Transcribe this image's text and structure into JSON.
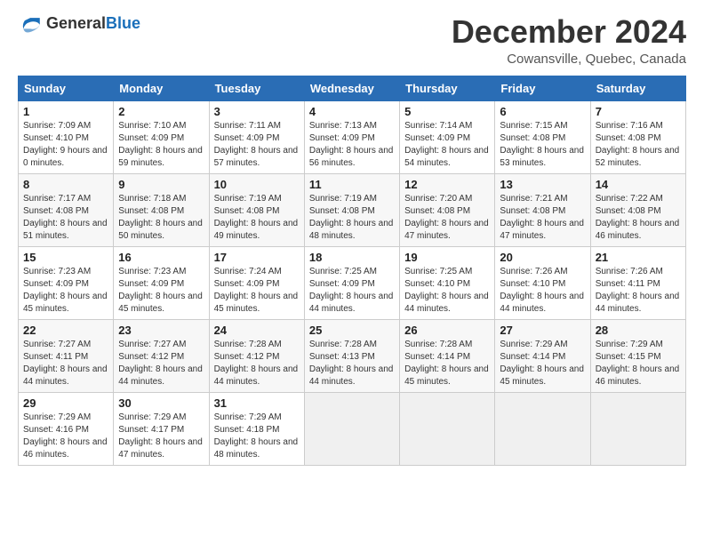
{
  "header": {
    "logo_general": "General",
    "logo_blue": "Blue",
    "month": "December 2024",
    "location": "Cowansville, Quebec, Canada"
  },
  "weekdays": [
    "Sunday",
    "Monday",
    "Tuesday",
    "Wednesday",
    "Thursday",
    "Friday",
    "Saturday"
  ],
  "weeks": [
    [
      {
        "day": "1",
        "sunrise": "7:09 AM",
        "sunset": "4:10 PM",
        "daylight": "9 hours and 0 minutes."
      },
      {
        "day": "2",
        "sunrise": "7:10 AM",
        "sunset": "4:09 PM",
        "daylight": "8 hours and 59 minutes."
      },
      {
        "day": "3",
        "sunrise": "7:11 AM",
        "sunset": "4:09 PM",
        "daylight": "8 hours and 57 minutes."
      },
      {
        "day": "4",
        "sunrise": "7:13 AM",
        "sunset": "4:09 PM",
        "daylight": "8 hours and 56 minutes."
      },
      {
        "day": "5",
        "sunrise": "7:14 AM",
        "sunset": "4:09 PM",
        "daylight": "8 hours and 54 minutes."
      },
      {
        "day": "6",
        "sunrise": "7:15 AM",
        "sunset": "4:08 PM",
        "daylight": "8 hours and 53 minutes."
      },
      {
        "day": "7",
        "sunrise": "7:16 AM",
        "sunset": "4:08 PM",
        "daylight": "8 hours and 52 minutes."
      }
    ],
    [
      {
        "day": "8",
        "sunrise": "7:17 AM",
        "sunset": "4:08 PM",
        "daylight": "8 hours and 51 minutes."
      },
      {
        "day": "9",
        "sunrise": "7:18 AM",
        "sunset": "4:08 PM",
        "daylight": "8 hours and 50 minutes."
      },
      {
        "day": "10",
        "sunrise": "7:19 AM",
        "sunset": "4:08 PM",
        "daylight": "8 hours and 49 minutes."
      },
      {
        "day": "11",
        "sunrise": "7:19 AM",
        "sunset": "4:08 PM",
        "daylight": "8 hours and 48 minutes."
      },
      {
        "day": "12",
        "sunrise": "7:20 AM",
        "sunset": "4:08 PM",
        "daylight": "8 hours and 47 minutes."
      },
      {
        "day": "13",
        "sunrise": "7:21 AM",
        "sunset": "4:08 PM",
        "daylight": "8 hours and 47 minutes."
      },
      {
        "day": "14",
        "sunrise": "7:22 AM",
        "sunset": "4:08 PM",
        "daylight": "8 hours and 46 minutes."
      }
    ],
    [
      {
        "day": "15",
        "sunrise": "7:23 AM",
        "sunset": "4:09 PM",
        "daylight": "8 hours and 45 minutes."
      },
      {
        "day": "16",
        "sunrise": "7:23 AM",
        "sunset": "4:09 PM",
        "daylight": "8 hours and 45 minutes."
      },
      {
        "day": "17",
        "sunrise": "7:24 AM",
        "sunset": "4:09 PM",
        "daylight": "8 hours and 45 minutes."
      },
      {
        "day": "18",
        "sunrise": "7:25 AM",
        "sunset": "4:09 PM",
        "daylight": "8 hours and 44 minutes."
      },
      {
        "day": "19",
        "sunrise": "7:25 AM",
        "sunset": "4:10 PM",
        "daylight": "8 hours and 44 minutes."
      },
      {
        "day": "20",
        "sunrise": "7:26 AM",
        "sunset": "4:10 PM",
        "daylight": "8 hours and 44 minutes."
      },
      {
        "day": "21",
        "sunrise": "7:26 AM",
        "sunset": "4:11 PM",
        "daylight": "8 hours and 44 minutes."
      }
    ],
    [
      {
        "day": "22",
        "sunrise": "7:27 AM",
        "sunset": "4:11 PM",
        "daylight": "8 hours and 44 minutes."
      },
      {
        "day": "23",
        "sunrise": "7:27 AM",
        "sunset": "4:12 PM",
        "daylight": "8 hours and 44 minutes."
      },
      {
        "day": "24",
        "sunrise": "7:28 AM",
        "sunset": "4:12 PM",
        "daylight": "8 hours and 44 minutes."
      },
      {
        "day": "25",
        "sunrise": "7:28 AM",
        "sunset": "4:13 PM",
        "daylight": "8 hours and 44 minutes."
      },
      {
        "day": "26",
        "sunrise": "7:28 AM",
        "sunset": "4:14 PM",
        "daylight": "8 hours and 45 minutes."
      },
      {
        "day": "27",
        "sunrise": "7:29 AM",
        "sunset": "4:14 PM",
        "daylight": "8 hours and 45 minutes."
      },
      {
        "day": "28",
        "sunrise": "7:29 AM",
        "sunset": "4:15 PM",
        "daylight": "8 hours and 46 minutes."
      }
    ],
    [
      {
        "day": "29",
        "sunrise": "7:29 AM",
        "sunset": "4:16 PM",
        "daylight": "8 hours and 46 minutes."
      },
      {
        "day": "30",
        "sunrise": "7:29 AM",
        "sunset": "4:17 PM",
        "daylight": "8 hours and 47 minutes."
      },
      {
        "day": "31",
        "sunrise": "7:29 AM",
        "sunset": "4:18 PM",
        "daylight": "8 hours and 48 minutes."
      },
      null,
      null,
      null,
      null
    ]
  ],
  "labels": {
    "sunrise": "Sunrise:",
    "sunset": "Sunset:",
    "daylight": "Daylight:"
  }
}
